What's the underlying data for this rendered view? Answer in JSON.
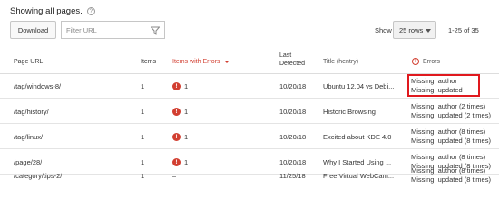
{
  "header": {
    "title": "Showing all pages.",
    "help_icon": "?"
  },
  "toolbar": {
    "download_label": "Download",
    "filter_placeholder": "Filter URL",
    "show_label": "Show",
    "rows_select_value": "25 rows",
    "range_label": "1-25 of 35"
  },
  "table": {
    "columns": {
      "page_url": "Page URL",
      "items": "Items",
      "items_with_errors": "Items with Errors",
      "last_detected": [
        "Last",
        "Detected"
      ],
      "title": "Title (hentry)",
      "errors": "Errors"
    },
    "rows": [
      {
        "url": "/tag/windows-8/",
        "items": "1",
        "errors_count": "1",
        "date": "10/20/18",
        "title": "Ubuntu 12.04 vs Debi...",
        "errors": [
          "Missing: author",
          "Missing: updated"
        ]
      },
      {
        "url": "/tag/history/",
        "items": "1",
        "errors_count": "1",
        "date": "10/20/18",
        "title": "Historic Browsing",
        "errors": [
          "Missing: author (2 times)",
          "Missing: updated (2 times)"
        ]
      },
      {
        "url": "/tag/linux/",
        "items": "1",
        "errors_count": "1",
        "date": "10/20/18",
        "title": "Excited about KDE 4.0",
        "errors": [
          "Missing: author (8 times)",
          "Missing: updated (8 times)"
        ]
      },
      {
        "url": "/page/28/",
        "items": "1",
        "errors_count": "1",
        "date": "10/20/18",
        "title": "Why I Started Using ...",
        "errors": [
          "Missing: author (8 times)",
          "Missing: updated (8 times)"
        ]
      },
      {
        "url": "/category/tips-2/",
        "items": "1",
        "errors_count": "–",
        "date": "11/25/18",
        "title": "Free Virtual WebCam...",
        "errors": [
          "Missing: author (8 times)",
          "Missing: updated (8 times)"
        ]
      }
    ]
  },
  "colors": {
    "error_red": "#d23f31",
    "highlight_red": "#e0191e"
  }
}
